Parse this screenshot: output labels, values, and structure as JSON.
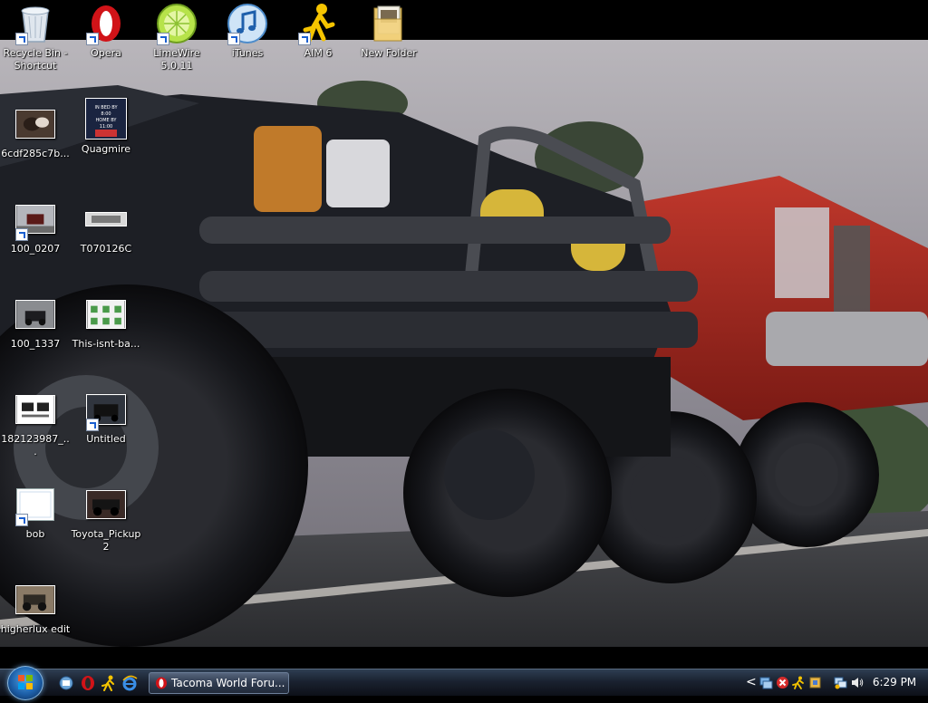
{
  "desktop": {
    "icons": [
      {
        "label": "Recycle Bin - Shortcut",
        "icon": "recycle-bin-icon"
      },
      {
        "label": "Opera",
        "icon": "opera-icon"
      },
      {
        "label": "LimeWire 5.0.11",
        "icon": "limewire-icon"
      },
      {
        "label": "iTunes",
        "icon": "itunes-icon"
      },
      {
        "label": "AIM 6",
        "icon": "aim-icon"
      },
      {
        "label": "New Folder",
        "icon": "folder-icon"
      },
      {
        "label": "6cdf285c7b...",
        "icon": "image-thumbnail-icon"
      },
      {
        "label": "Quagmire",
        "icon": "image-thumbnail-icon"
      },
      {
        "label": "100_0207",
        "icon": "image-thumbnail-icon"
      },
      {
        "label": "T070126C",
        "icon": "image-thumbnail-icon"
      },
      {
        "label": "100_1337",
        "icon": "image-thumbnail-icon"
      },
      {
        "label": "This-isnt-ba...",
        "icon": "image-thumbnail-icon"
      },
      {
        "label": "182123987_...",
        "icon": "image-thumbnail-icon"
      },
      {
        "label": "Untitled",
        "icon": "image-thumbnail-icon"
      },
      {
        "label": "bob",
        "icon": "image-thumbnail-icon"
      },
      {
        "label": "Toyota_Pickup2",
        "icon": "image-thumbnail-icon"
      },
      {
        "label": "higherlux edit",
        "icon": "image-thumbnail-icon"
      }
    ],
    "quagmire_thumb_text": "IN BED BY 8:00 HOME BY 11:00"
  },
  "taskbar": {
    "start_button": "start-orb",
    "quick_launch": [
      "show-desktop-icon",
      "opera-icon",
      "aim-icon",
      "internet-explorer-icon"
    ],
    "tasks": [
      {
        "label": "Tacoma World Foru...",
        "icon": "opera-icon"
      }
    ],
    "tray": {
      "expand_glyph": "<",
      "clock": "6:29 PM"
    }
  },
  "colors": {
    "taskbar_top": "#2e3e52",
    "taskbar_bottom": "#0d1018",
    "truck_black": "#1b1d22",
    "truck_red": "#b02a22",
    "sky": "#8e8a90",
    "road": "#3a3a3c"
  }
}
